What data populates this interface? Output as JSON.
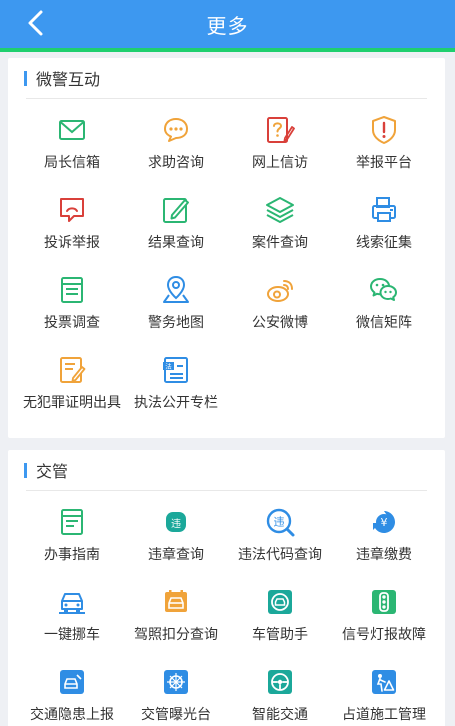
{
  "header": {
    "title": "更多",
    "back": "back"
  },
  "sections": [
    {
      "title": "微警互动",
      "items": [
        {
          "label": "局长信箱",
          "icon": "mail-icon"
        },
        {
          "label": "求助咨询",
          "icon": "chat-bubble-icon"
        },
        {
          "label": "网上信访",
          "icon": "question-edit-icon"
        },
        {
          "label": "举报平台",
          "icon": "shield-alert-icon"
        },
        {
          "label": "投诉举报",
          "icon": "complaint-icon"
        },
        {
          "label": "结果查询",
          "icon": "edit-document-icon"
        },
        {
          "label": "案件查询",
          "icon": "layers-icon"
        },
        {
          "label": "线索征集",
          "icon": "printer-icon"
        },
        {
          "label": "投票调查",
          "icon": "vote-form-icon"
        },
        {
          "label": "警务地图",
          "icon": "map-pin-icon"
        },
        {
          "label": "公安微博",
          "icon": "weibo-icon"
        },
        {
          "label": "微信矩阵",
          "icon": "wechat-icon"
        },
        {
          "label": "无犯罪证明出具",
          "icon": "certificate-icon"
        },
        {
          "label": "执法公开专栏",
          "icon": "law-document-icon"
        }
      ]
    },
    {
      "title": "交管",
      "items": [
        {
          "label": "办事指南",
          "icon": "guide-document-icon"
        },
        {
          "label": "违章查询",
          "icon": "violation-query-icon",
          "badge": "违"
        },
        {
          "label": "违法代码查询",
          "icon": "violation-code-icon",
          "badge": "违"
        },
        {
          "label": "违章缴费",
          "icon": "payment-icon",
          "badge": "¥"
        },
        {
          "label": "一键挪车",
          "icon": "move-car-icon"
        },
        {
          "label": "驾照扣分查询",
          "icon": "license-points-icon"
        },
        {
          "label": "车管助手",
          "icon": "car-assistant-icon"
        },
        {
          "label": "信号灯报故障",
          "icon": "traffic-light-icon"
        },
        {
          "label": "交通隐患上报",
          "icon": "hazard-report-icon"
        },
        {
          "label": "交管曝光台",
          "icon": "exposure-icon"
        },
        {
          "label": "智能交通",
          "icon": "smart-traffic-icon"
        },
        {
          "label": "占道施工管理",
          "icon": "road-work-icon"
        }
      ]
    }
  ],
  "colors": {
    "header": "#3d98f0",
    "accent_line": "#1fcf6e",
    "green": "#2bb673",
    "red": "#d9403a",
    "orange": "#f0a33a",
    "blue": "#2f8de4",
    "teal": "#1ba89a"
  }
}
